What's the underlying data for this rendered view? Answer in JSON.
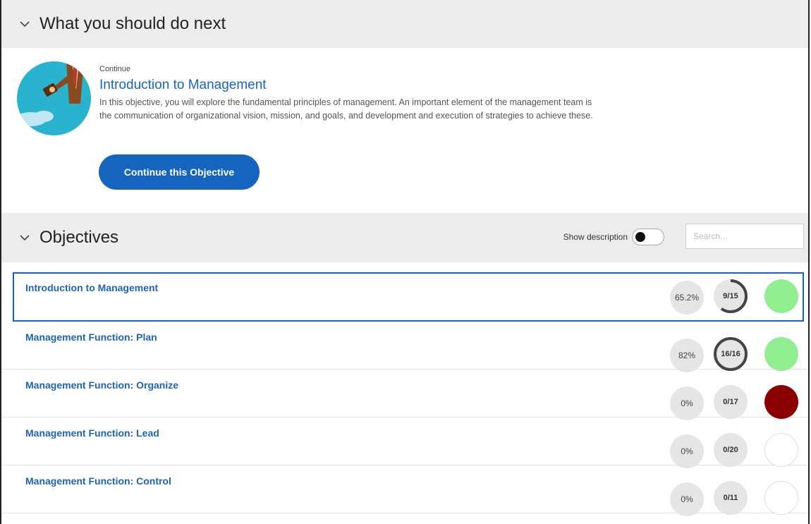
{
  "next": {
    "header_title": "What you should do next",
    "continue_label": "Continue",
    "title": "Introduction to Management",
    "description": "In this objective, you will explore the fundamental principles of management. An important element of the management team is the communication of organizational vision, mission, and goals, and development and execution of strategies to achieve these.",
    "button_label": "Continue this Objective"
  },
  "objectives": {
    "header_title": "Objectives",
    "toggle_label": "Show description",
    "search_placeholder": "Search...",
    "items": [
      {
        "name": "Introduction to Management",
        "percent": "65.2%",
        "progress_text": "9/15",
        "progress_fraction": 0.6,
        "status_color": "#90ee90",
        "selected": true
      },
      {
        "name": "Management Function: Plan",
        "percent": "82%",
        "progress_text": "16/16",
        "progress_fraction": 1.0,
        "status_color": "#90ee90",
        "selected": false
      },
      {
        "name": "Management Function: Organize",
        "percent": "0%",
        "progress_text": "0/17",
        "progress_fraction": 0.0,
        "status_color": "#8b0000",
        "selected": false
      },
      {
        "name": "Management Function: Lead",
        "percent": "0%",
        "progress_text": "0/20",
        "progress_fraction": 0.0,
        "status_color": "#ffffff",
        "selected": false
      },
      {
        "name": "Management Function: Control",
        "percent": "0%",
        "progress_text": "0/11",
        "progress_fraction": 0.0,
        "status_color": "#ffffff",
        "selected": false
      }
    ]
  },
  "colors": {
    "accent": "#1565c0",
    "header_bg": "#ececec"
  },
  "icons": {
    "collapse": "chevron-down-icon"
  }
}
